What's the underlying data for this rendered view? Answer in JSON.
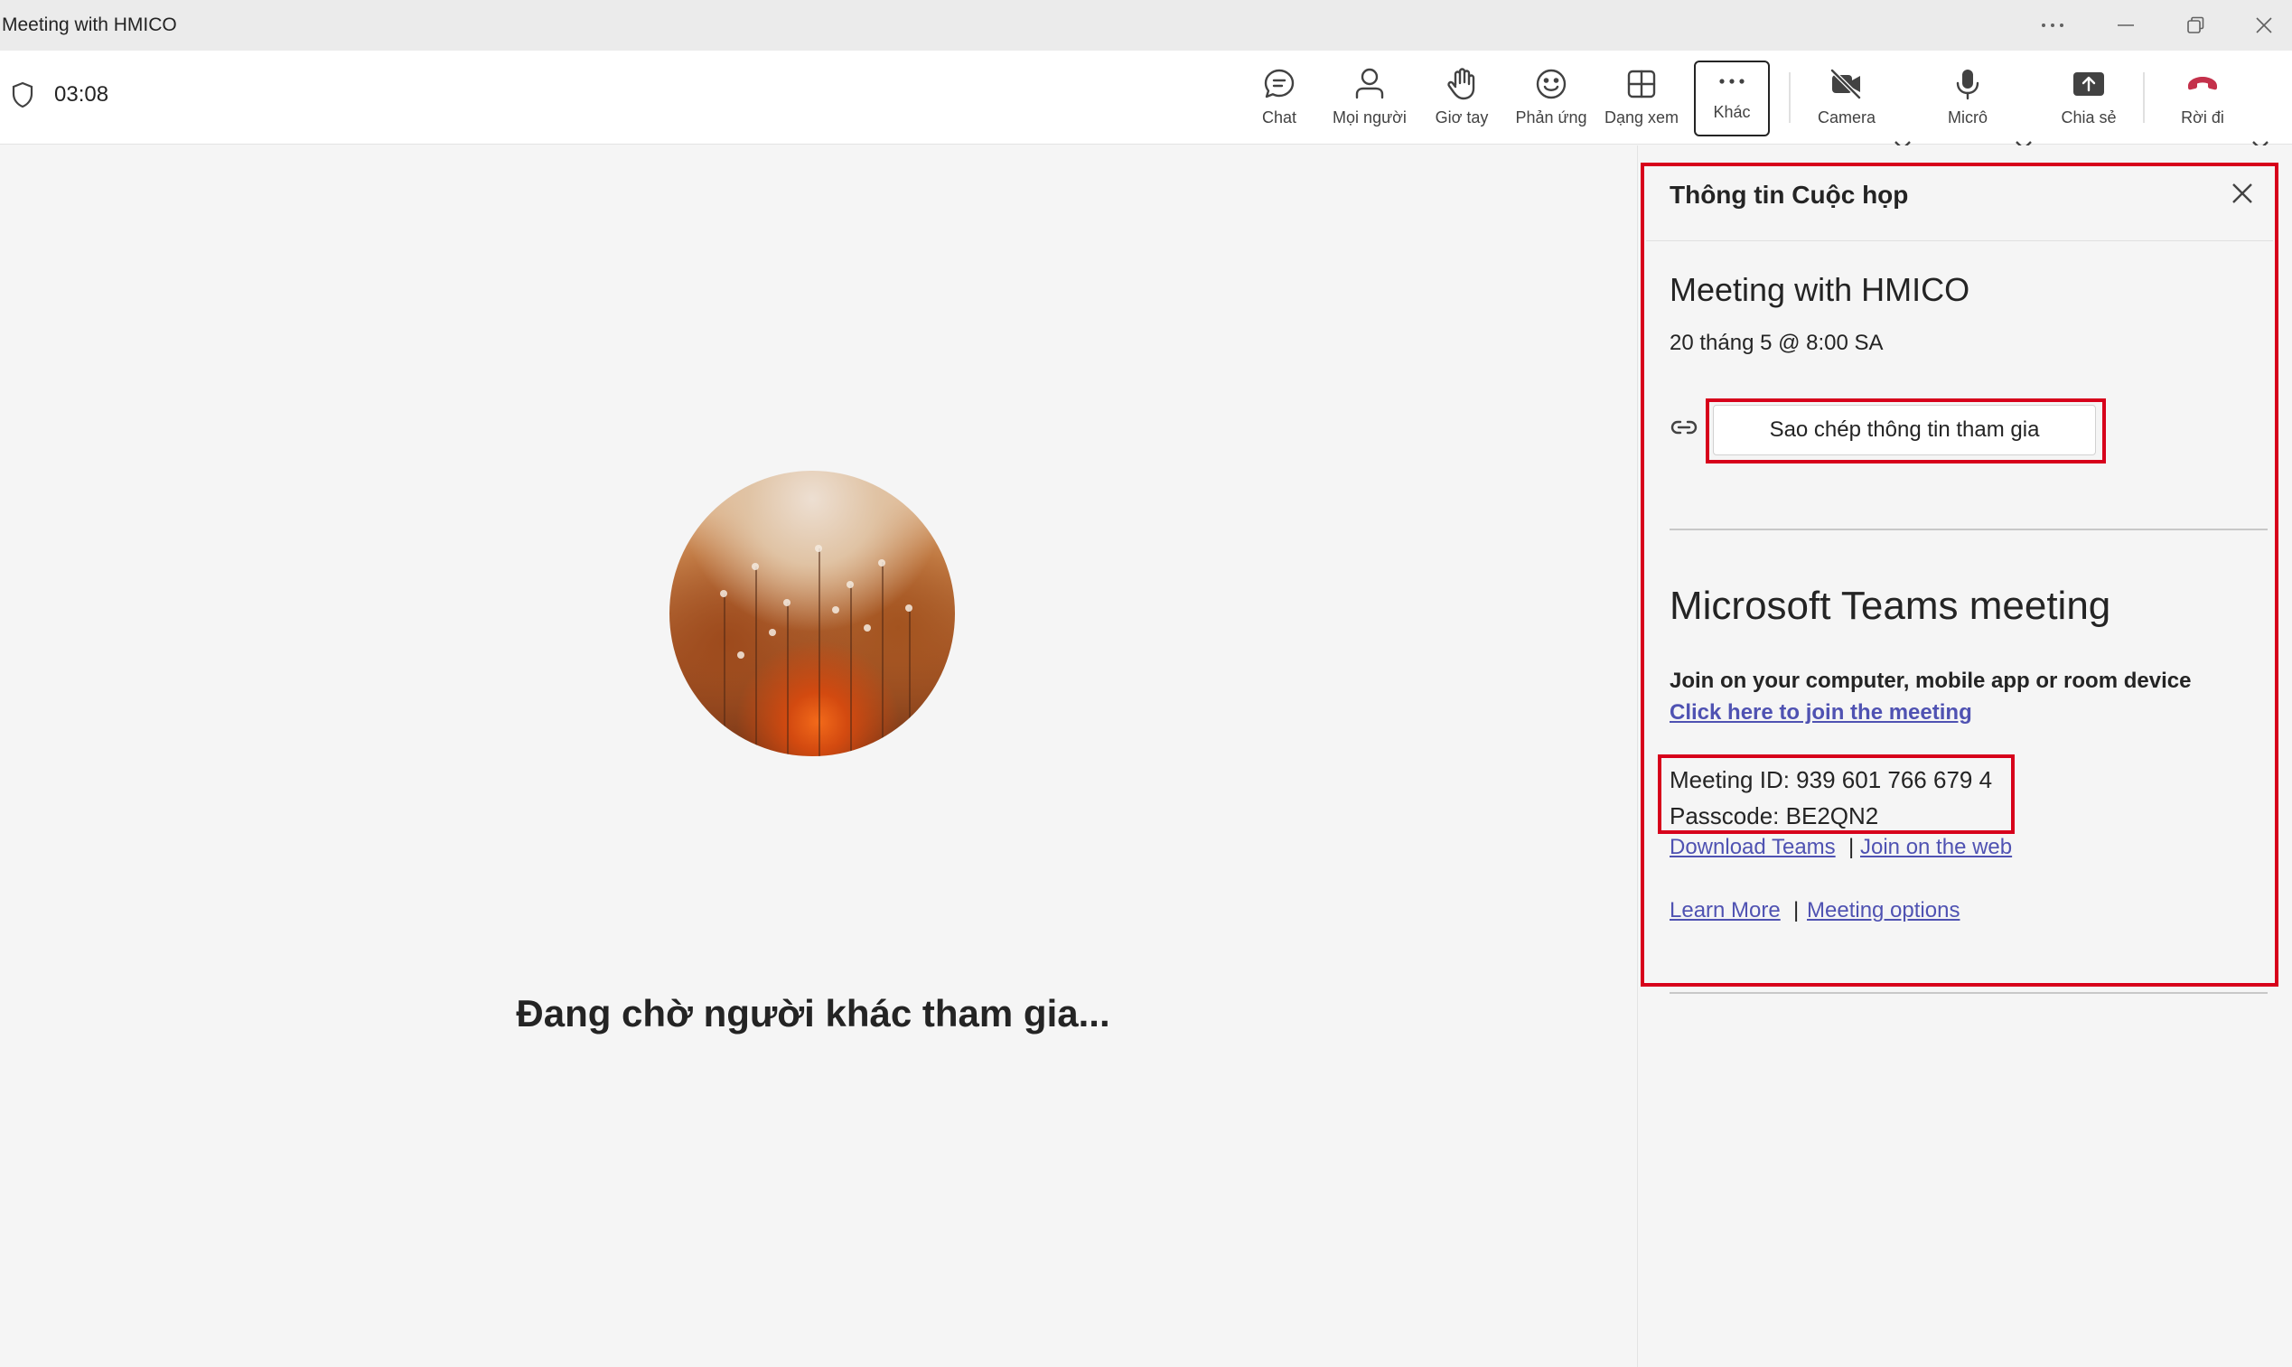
{
  "window": {
    "title": "Meeting with HMICO",
    "controls": [
      "more-options",
      "minimize",
      "restore",
      "close"
    ]
  },
  "toolbar": {
    "timer": "03:08",
    "buttons": [
      {
        "label": "Chat",
        "icon": "chat-icon"
      },
      {
        "label": "Mọi người",
        "icon": "people-icon"
      },
      {
        "label": "Giơ tay",
        "icon": "raise-hand-icon"
      },
      {
        "label": "Phản ứng",
        "icon": "smile-icon"
      },
      {
        "label": "Dạng xem",
        "icon": "grid-view-icon"
      },
      {
        "label": "Khác",
        "icon": "more-icon",
        "active": true
      },
      {
        "label": "Camera",
        "icon": "camera-off-icon"
      },
      {
        "label": "Micrô",
        "icon": "mic-icon"
      },
      {
        "label": "Chia sẻ",
        "icon": "share-icon"
      },
      {
        "label": "Rời đi",
        "icon": "hang-up-icon"
      }
    ],
    "hangup_color": "#c4314b"
  },
  "stage": {
    "waiting_text": "Đang chờ người khác tham gia..."
  },
  "panel": {
    "header": "Thông tin Cuộc họp",
    "meeting_title": "Meeting with HMICO",
    "date": "20 tháng 5 @ 8:00 SA",
    "copy_button": "Sao chép thông tin tham gia",
    "teams_title": "Microsoft Teams meeting",
    "join_line": "Join on your computer, mobile app or room device",
    "join_link": "Click here to join the meeting",
    "meeting_id": "Meeting ID: 939 601 766 679 4",
    "passcode": "Passcode: BE2QN2",
    "link_download": "Download Teams",
    "link_web": "Join on the web",
    "link_learn": "Learn More",
    "link_options": "Meeting options",
    "separator": "|"
  },
  "colors": {
    "highlight": "#d7001b",
    "link": "#4f52b2",
    "background": "#f5f5f5"
  }
}
